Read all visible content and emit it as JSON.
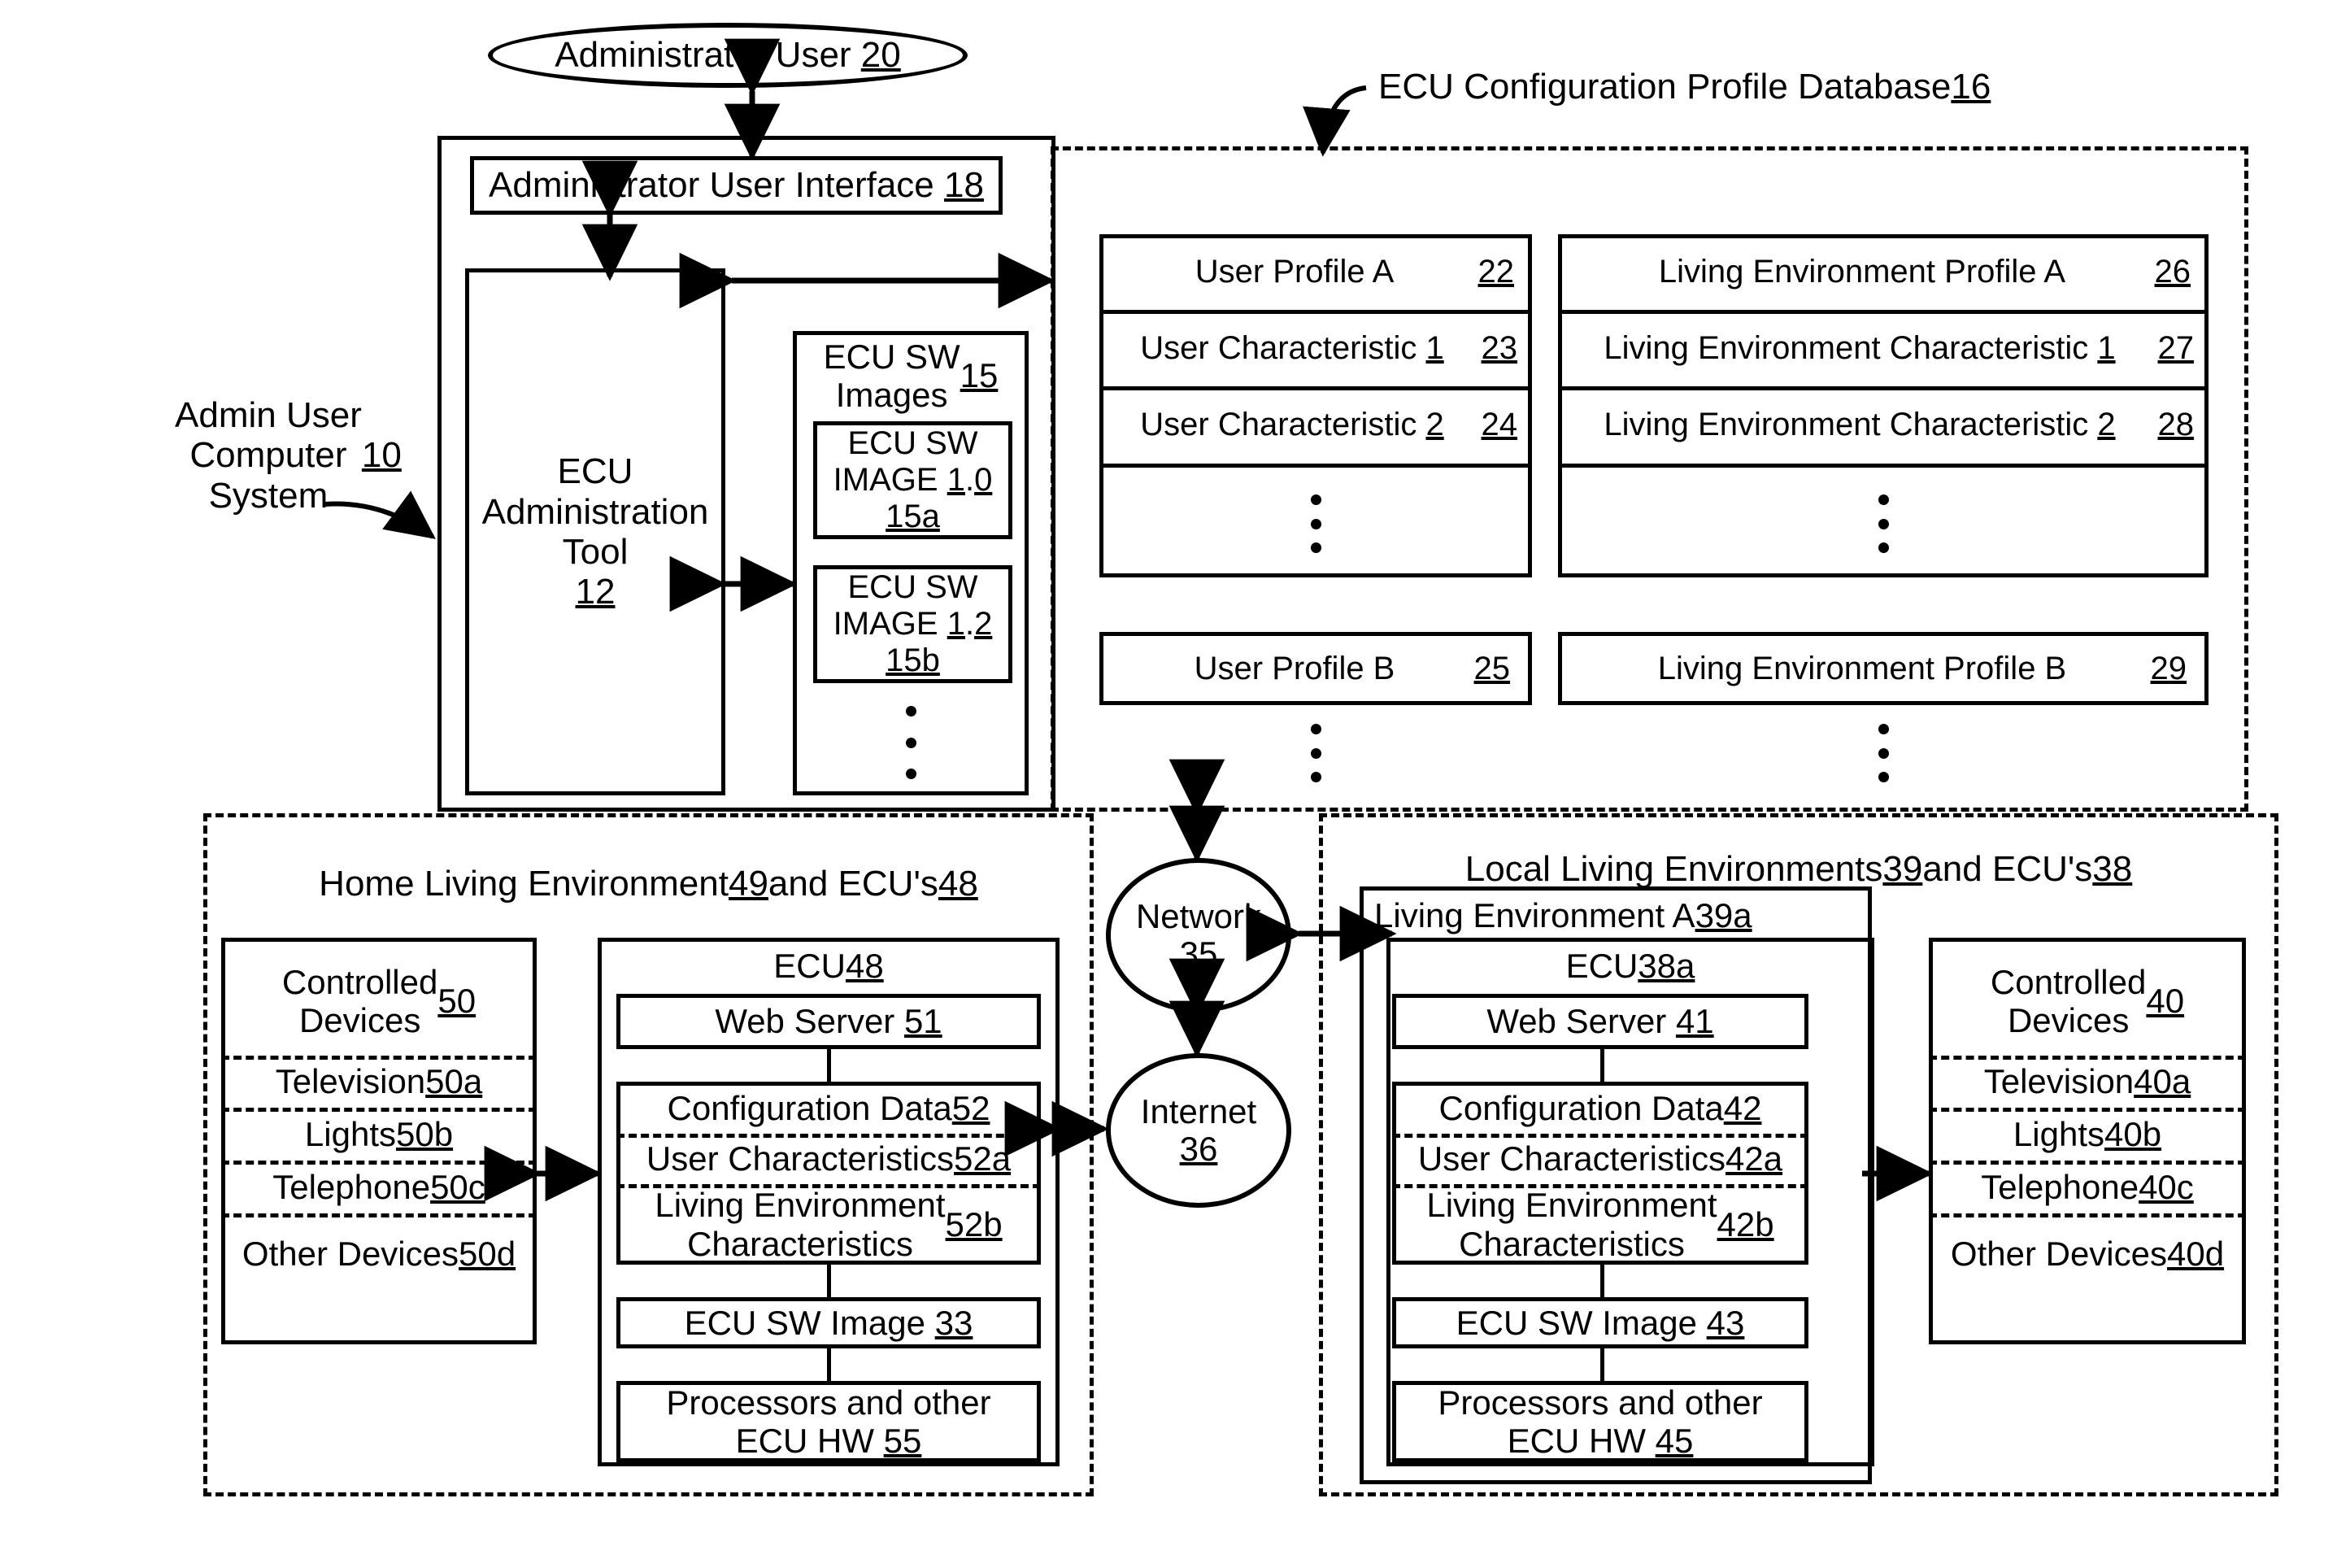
{
  "figure": {
    "actor": "Administrator User 20",
    "admin_system_label": "Admin User\nComputer\nSystem 10",
    "db_label": "ECU Configuration Profile Database 16",
    "admin_ui": "Administrator User Interface 18",
    "admin_tool": "ECU\nAdministration\nTool\n12",
    "sw_images_title": "ECU SW\nImages 15",
    "sw_image_a": "ECU SW\nIMAGE 1.0\n15a",
    "sw_image_b": "ECU SW\nIMAGE 1.2\n15b"
  },
  "database": {
    "user_column": [
      {
        "label": "User Profile A",
        "ref": "22"
      },
      {
        "label": "User Characteristic 1",
        "ref": "23"
      },
      {
        "label": "User Characteristic 2",
        "ref": "24"
      }
    ],
    "user_profile_b": {
      "label": "User Profile B",
      "ref": "25"
    },
    "env_column": [
      {
        "label": "Living Environment Profile A",
        "ref": "26"
      },
      {
        "label": "Living Environment Characteristic 1",
        "ref": "27"
      },
      {
        "label": "Living Environment Characteristic 2",
        "ref": "28"
      }
    ],
    "env_profile_b": {
      "label": "Living Environment Profile B",
      "ref": "29"
    }
  },
  "network": {
    "network": "Network\n35",
    "internet": "Internet\n36"
  },
  "home": {
    "title": "Home Living Environment 49 and ECU's 48",
    "devices": {
      "title": "Controlled\nDevices\n50",
      "items": [
        "Television 50a",
        "Lights 50b",
        "Telephone 50c",
        "Other Devices\n50d"
      ]
    },
    "ecu": {
      "title": "ECU 48",
      "web_server": "Web Server 51",
      "config_data": "Configuration Data 52",
      "user_chars": "User Characteristics 52a",
      "env_chars": "Living Environment\nCharacteristics 52b",
      "sw_image": "ECU SW Image 33",
      "hardware": "Processors and other\nECU HW 55"
    }
  },
  "local": {
    "title": "Local Living Environments 39 and ECU's 38",
    "env_a_title": "Living Environment A 39a",
    "ecu": {
      "title": "ECU 38a",
      "web_server": "Web Server 41",
      "config_data": "Configuration Data 42",
      "user_chars": "User Characteristics 42a",
      "env_chars": "Living Environment\nCharacteristics 42b",
      "sw_image": "ECU SW Image 43",
      "hardware": "Processors and other\nECU HW 45"
    },
    "devices": {
      "title": "Controlled\nDevices\n40",
      "items": [
        "Television 40a",
        "Lights 40b",
        "Telephone 40c",
        "Other Devices\n40d"
      ]
    }
  }
}
